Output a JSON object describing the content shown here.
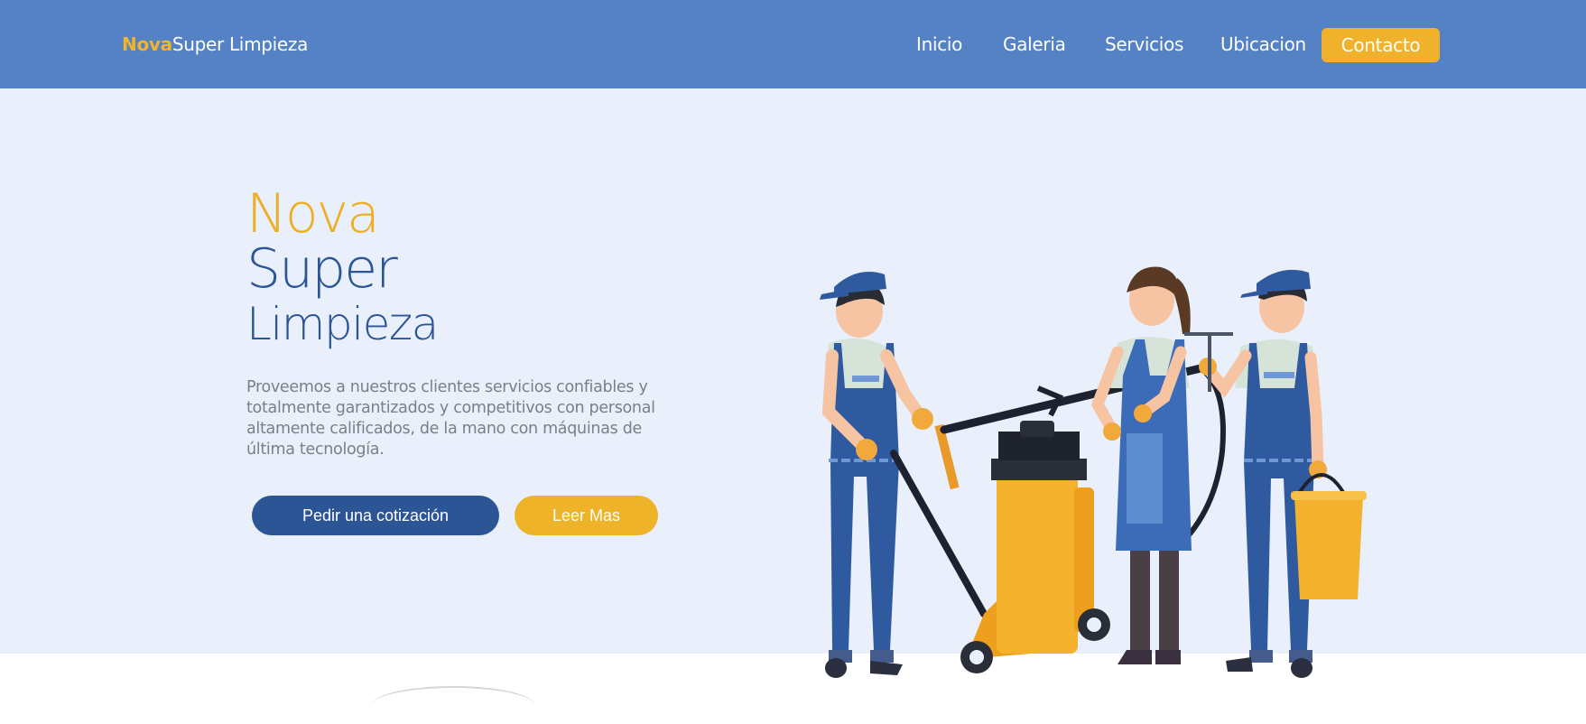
{
  "header": {
    "brand_accent": "Nova",
    "brand_rest": "Super Limpieza",
    "nav": [
      "Inicio",
      "Galeria",
      "Servicios",
      "Ubicacion"
    ],
    "contact_label": "Contacto",
    "background_color": "#5482c5",
    "accent_color": "#f0b22b"
  },
  "hero": {
    "title_line1": "Nova",
    "title_line2": "Super",
    "title_line3": "Limpieza",
    "description": "Proveemos a nuestros clientes servicios confiables y totalmente garantizados y competitivos con personal altamente calificados, de la mano con máquinas de última tecnología.",
    "primary_button": "Pedir una cotización",
    "secondary_button": "Leer Mas",
    "background_color": "#e9f0fb",
    "illustration": "cleaning-crew-illustration"
  }
}
